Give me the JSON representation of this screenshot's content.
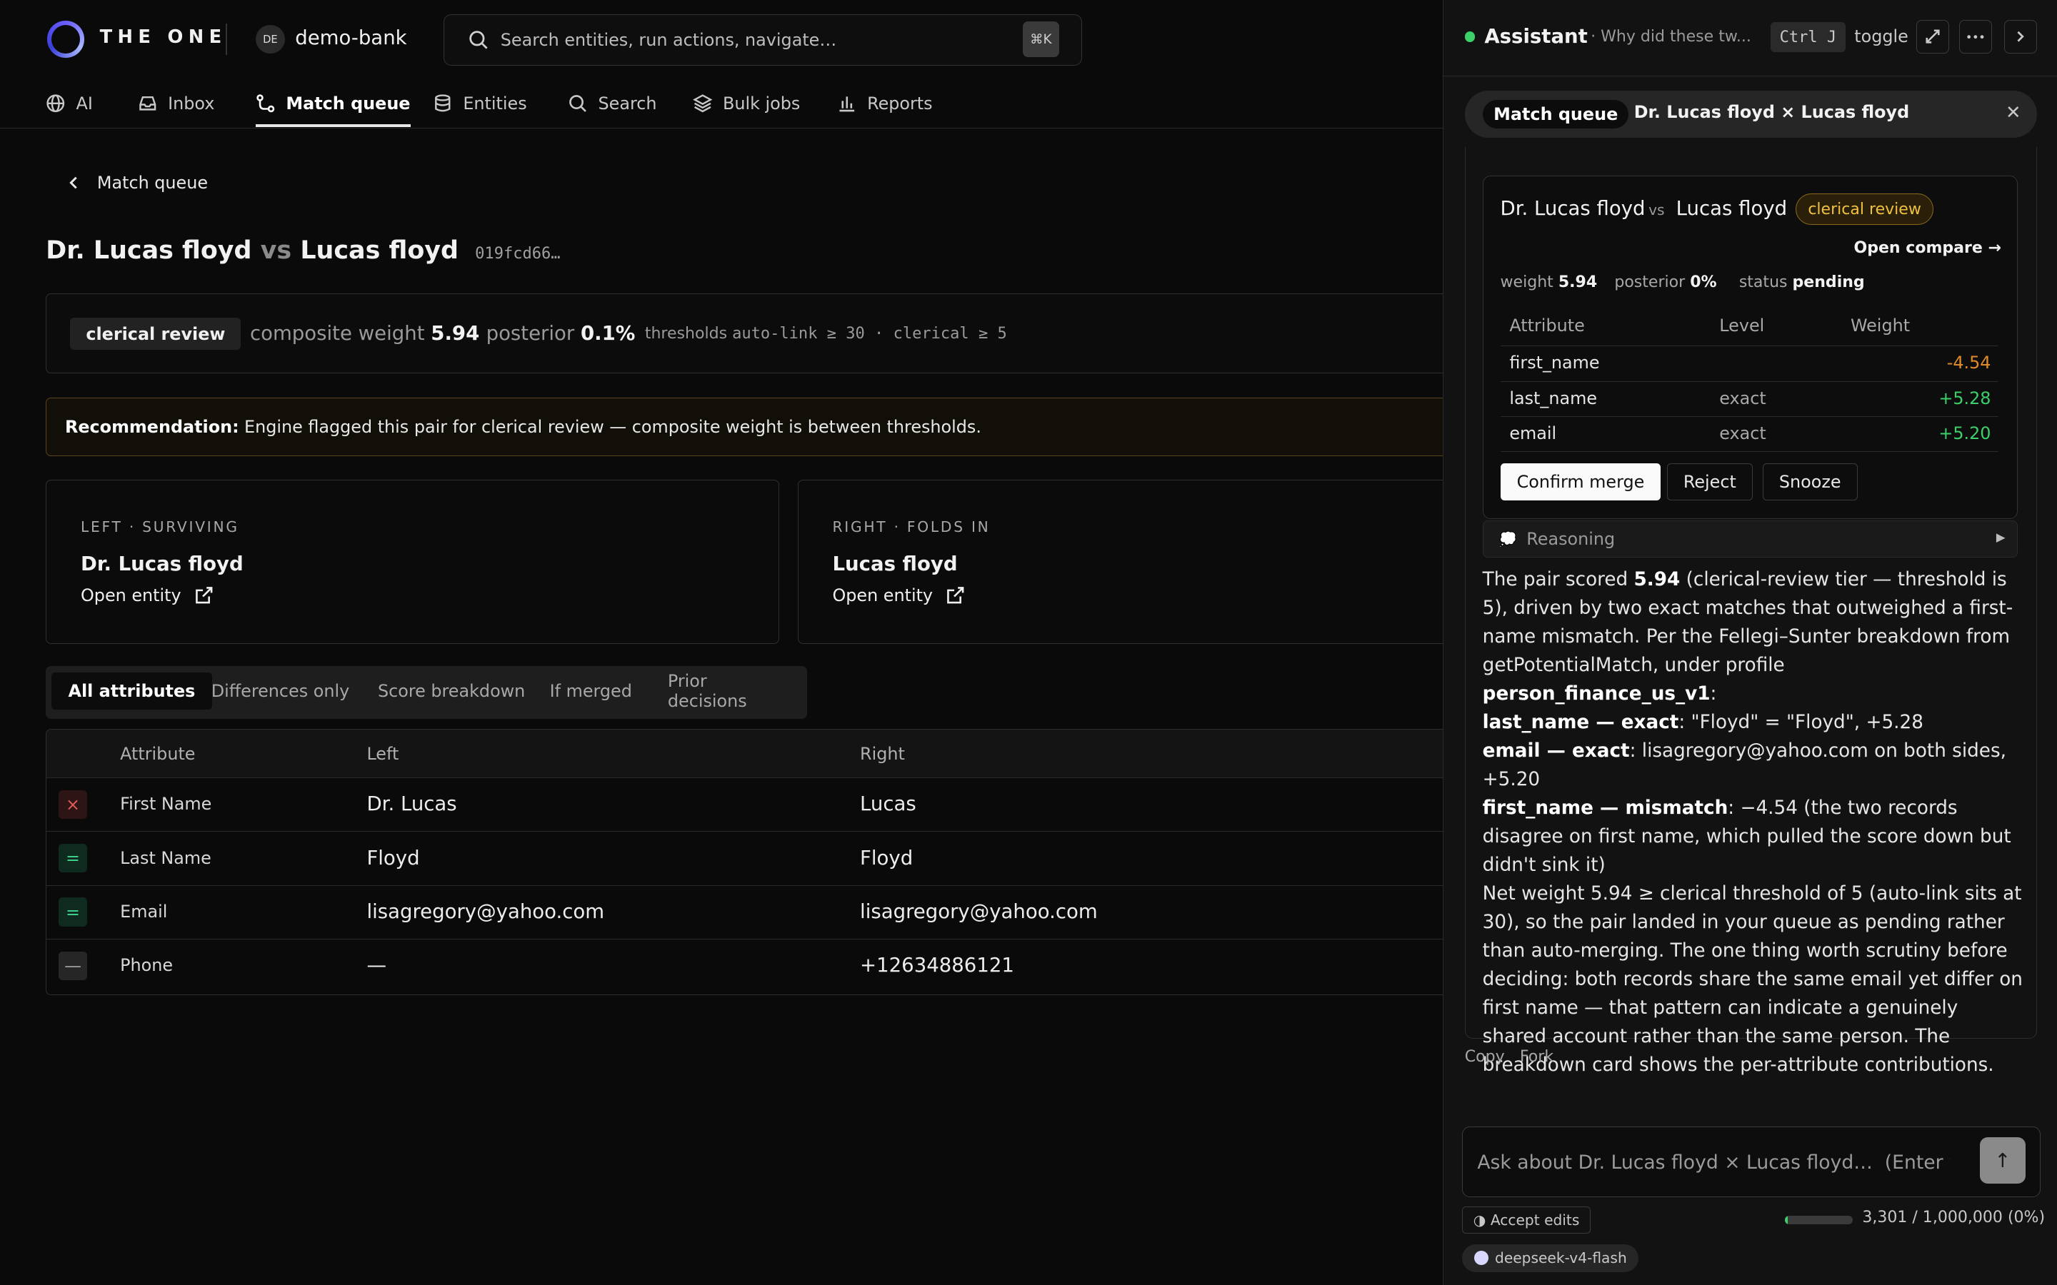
{
  "app": {
    "brand": "THE ONE",
    "workspace_initials": "DE",
    "workspace": "demo-bank"
  },
  "search": {
    "placeholder": "Search entities, run actions, navigate…",
    "shortcut": "⌘K"
  },
  "nav": [
    {
      "label": "AI",
      "icon": "globe-icon"
    },
    {
      "label": "Inbox",
      "icon": "inbox-icon"
    },
    {
      "label": "Match queue",
      "icon": "route-icon",
      "active": true
    },
    {
      "label": "Entities",
      "icon": "database-icon"
    },
    {
      "label": "Search",
      "icon": "search-icon"
    },
    {
      "label": "Bulk jobs",
      "icon": "layers-icon"
    },
    {
      "label": "Reports",
      "icon": "bar-chart-icon"
    }
  ],
  "page": {
    "back_label": "Match queue",
    "title_left": "Dr. Lucas floyd",
    "title_vs": "vs",
    "title_right": "Lucas floyd",
    "id": "019fcd66…"
  },
  "score": {
    "badge": "clerical review",
    "composite_label": "composite weight",
    "composite_value": "5.94",
    "posterior_label": "posterior",
    "posterior_value": "0.1%",
    "thresholds_label": "thresholds",
    "thresholds_value": "auto-link ≥ 30 · clerical ≥ 5"
  },
  "recommendation": {
    "label": "Recommendation:",
    "text": "Engine flagged this pair for clerical review — composite weight is between thresholds."
  },
  "left_card": {
    "caption": "LEFT · SURVIVING",
    "name": "Dr. Lucas floyd",
    "link": "Open entity"
  },
  "right_card": {
    "caption": "RIGHT · FOLDS IN",
    "name": "Lucas floyd",
    "link": "Open entity"
  },
  "tabs": [
    "All attributes",
    "Differences only",
    "Score breakdown",
    "If merged",
    "Prior decisions"
  ],
  "table": {
    "headers": [
      "Attribute",
      "Left",
      "Right"
    ],
    "rows": [
      {
        "status": "mismatch",
        "mark": "×",
        "attribute": "First Name",
        "left": "Dr. Lucas",
        "right": "Lucas"
      },
      {
        "status": "equal",
        "mark": "=",
        "attribute": "Last Name",
        "left": "Floyd",
        "right": "Floyd"
      },
      {
        "status": "equal",
        "mark": "=",
        "attribute": "Email",
        "left": "lisagregory@yahoo.com",
        "right": "lisagregory@yahoo.com"
      },
      {
        "status": "missing",
        "mark": "—",
        "attribute": "Phone",
        "left": "—",
        "right": "+12634886121"
      }
    ]
  },
  "assistant": {
    "title": "Assistant",
    "subtitle": "· Why did these tw...",
    "shortcut": "Ctrl J",
    "toggle": "toggle",
    "context_tag": "Match queue",
    "context_name": "Dr. Lucas floyd × Lucas floyd",
    "card": {
      "left": "Dr. Lucas floyd",
      "vs": "vs",
      "right": "Lucas floyd",
      "badge": "clerical review",
      "open_compare": "Open compare →",
      "weight_label": "weight",
      "weight_value": "5.94",
      "posterior_label": "posterior",
      "posterior_value": "0%",
      "status_label": "status",
      "status_value": "pending",
      "headers": [
        "Attribute",
        "Level",
        "Weight"
      ],
      "rows": [
        {
          "attribute": "first_name",
          "level": "",
          "weight": "-4.54",
          "sign": "neg"
        },
        {
          "attribute": "last_name",
          "level": "exact",
          "weight": "+5.28",
          "sign": "pos"
        },
        {
          "attribute": "email",
          "level": "exact",
          "weight": "+5.20",
          "sign": "pos"
        }
      ],
      "buttons": [
        "Confirm merge",
        "Reject",
        "Snooze"
      ]
    },
    "reasoning_label": "Reasoning",
    "message": {
      "p1a": "The pair scored ",
      "p1b": "5.94",
      "p1c": " (clerical-review tier — threshold is 5), driven by two exact matches that outweighed a first-name mismatch. Per the Fellegi–Sunter breakdown from getPotentialMatch, under profile ",
      "p1d": "person_finance_us_v1",
      "p1e": ":",
      "l1a": "last_name — exact",
      "l1b": ": \"Floyd\" = \"Floyd\", +5.28",
      "l2a": "email — exact",
      "l2b": ": lisagregory@yahoo.com on both sides, +5.20",
      "l3a": "first_name — mismatch",
      "l3b": ": −4.54 (the two records disagree on first name, which pulled the score down but didn't sink it)",
      "p2": "Net weight 5.94 ≥ clerical threshold of 5 (auto-link sits at 30), so the pair landed in your queue as pending rather than auto-merging. The one thing worth scrutiny before deciding: both records share the same email yet differ on first name — that pattern can indicate a genuinely shared account rather than the same person. The breakdown card shows the per-attribute contributions."
    },
    "copy": "Copy",
    "fork": "Fork",
    "composer_placeholder": "Ask about Dr. Lucas floyd × Lucas floyd…  (Enter to send)",
    "accept_edits": "Accept edits",
    "tokens": "3,301 / 1,000,000 (0%)",
    "token_fraction": 0.0033,
    "model": "deepseek-v4-flash"
  }
}
